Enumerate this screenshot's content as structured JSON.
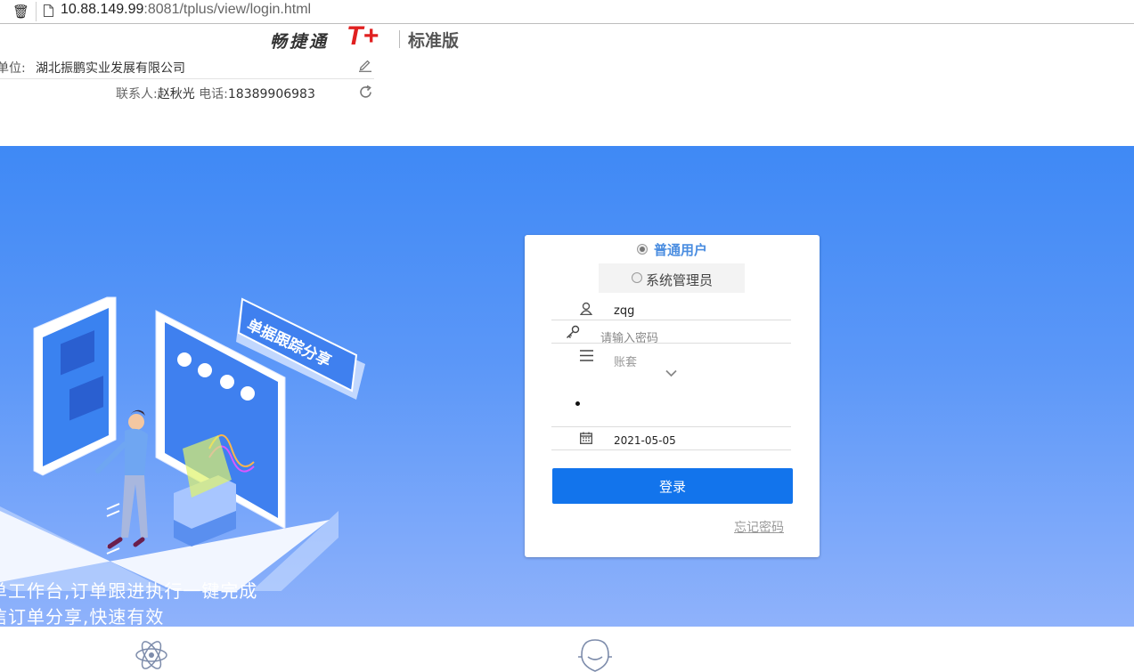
{
  "browser": {
    "url_host": "10.88.149.99",
    "url_rest": ":8081/tplus/view/login.html"
  },
  "header": {
    "brand_cn": "畅捷通",
    "brand_product": "T+",
    "edition": "标准版",
    "company_label": "单位:",
    "company_name": "湖北振鹏实业发展有限公司",
    "contact_label": "联系人:",
    "contact_name": "赵秋光",
    "phone_label": "电话:",
    "phone": "18389906983"
  },
  "banner": {
    "illustration_sign": "单据跟踪分享",
    "slogan_line1": "单工作台,订单跟进执行一键完成",
    "slogan_line2": "信订单分享,快速有效",
    "background_top": "#3f89f5",
    "background_bottom": "#8fb2fb"
  },
  "login": {
    "role_normal": "普通用户",
    "role_admin": "系统管理员",
    "selected_role": "普通用户",
    "username": "zqg",
    "password_placeholder": "请输入密码",
    "account_placeholder": "账套",
    "date": "2021-05-05",
    "login_button": "登录",
    "forgot_password": "忘记密码",
    "accent_color": "#1274ec"
  },
  "icons": [
    "trash-icon",
    "page-icon",
    "edit-icon",
    "refresh-icon",
    "user-icon",
    "key-icon",
    "menu-icon",
    "chevron-down-icon",
    "calendar-icon",
    "atom-icon",
    "support-icon"
  ]
}
